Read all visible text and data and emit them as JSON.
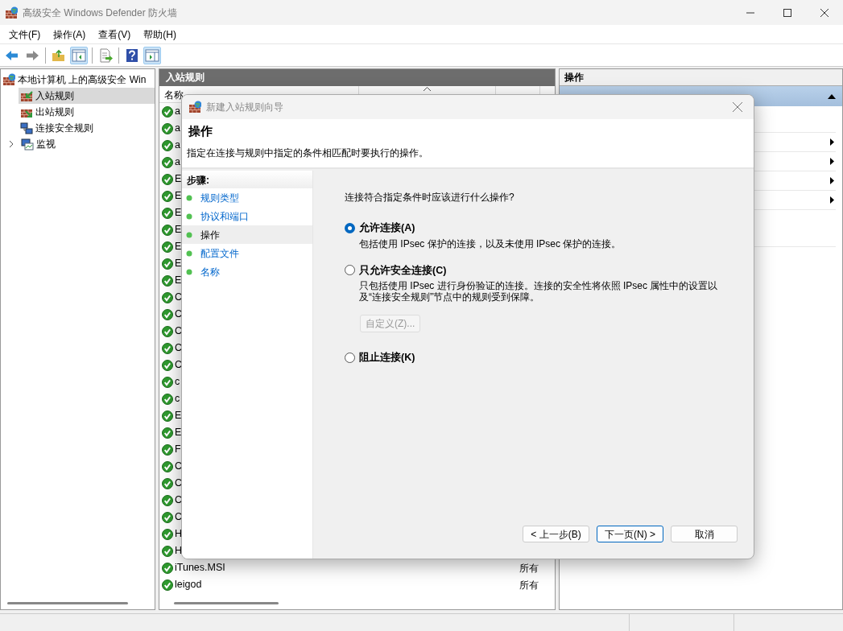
{
  "window": {
    "title": "高级安全 Windows Defender 防火墙"
  },
  "menu": [
    "文件(F)",
    "操作(A)",
    "查看(V)",
    "帮助(H)"
  ],
  "toolbar": [
    [
      {
        "kind": "back",
        "on": false
      },
      {
        "kind": "forward",
        "on": false
      }
    ],
    [
      {
        "kind": "up",
        "on": false
      },
      {
        "kind": "tree",
        "on": true
      }
    ],
    [
      {
        "kind": "export",
        "on": false
      }
    ],
    [
      {
        "kind": "help",
        "on": false
      },
      {
        "kind": "pane",
        "on": true
      }
    ]
  ],
  "tree": {
    "label": "本地计算机 上的高级安全 Win",
    "children": [
      {
        "label": "入站规则",
        "kind": "inbound",
        "selected": true
      },
      {
        "label": "出站规则",
        "kind": "outbound",
        "selected": false
      },
      {
        "label": "连接安全规则",
        "kind": "security",
        "selected": false
      },
      {
        "label": "监视",
        "kind": "monitor",
        "selected": false,
        "expanded": false
      }
    ]
  },
  "rules": {
    "title": "入站规则",
    "columns": [
      {
        "label": "名称",
        "sorted": false
      },
      {
        "sorted": true
      }
    ],
    "rows": [
      {
        "name": "a",
        "enabled": true
      },
      {
        "name": "a",
        "enabled": true
      },
      {
        "name": "a",
        "enabled": true
      },
      {
        "name": "a",
        "enabled": true
      },
      {
        "name": "E",
        "enabled": true
      },
      {
        "name": "E",
        "enabled": true
      },
      {
        "name": "E",
        "enabled": true
      },
      {
        "name": "E",
        "enabled": true
      },
      {
        "name": "E",
        "enabled": true
      },
      {
        "name": "E",
        "enabled": true
      },
      {
        "name": "E",
        "enabled": true
      },
      {
        "name": "C",
        "enabled": true
      },
      {
        "name": "C",
        "enabled": true
      },
      {
        "name": "C",
        "enabled": true
      },
      {
        "name": "C",
        "enabled": true
      },
      {
        "name": "C",
        "enabled": true
      },
      {
        "name": "c",
        "enabled": true
      },
      {
        "name": "c",
        "enabled": true
      },
      {
        "name": "E",
        "enabled": true
      },
      {
        "name": "E",
        "enabled": true
      },
      {
        "name": "F",
        "enabled": true
      },
      {
        "name": "C",
        "enabled": true
      },
      {
        "name": "C",
        "enabled": true
      },
      {
        "name": "C",
        "enabled": true
      },
      {
        "name": "C",
        "enabled": true
      },
      {
        "name": "H",
        "enabled": true
      },
      {
        "name": "H",
        "enabled": true
      },
      {
        "name": "iTunes.MSI",
        "enabled": true,
        "profile": "所有"
      },
      {
        "name": "leigod",
        "enabled": true,
        "profile": "所有"
      }
    ]
  },
  "actions": {
    "title": "操作",
    "items": [
      {
        "kind": "section",
        "expanded": true
      },
      {
        "kind": "plain"
      },
      {
        "kind": "submenu"
      },
      {
        "kind": "submenu"
      },
      {
        "kind": "submenu"
      },
      {
        "kind": "submenu"
      },
      {
        "kind": "plain"
      }
    ]
  },
  "dialog": {
    "title": "新建入站规则向导",
    "heading": "操作",
    "description": "指定在连接与规则中指定的条件相匹配时要执行的操作。",
    "steps_title": "步骤:",
    "steps": [
      {
        "label": "规则类型",
        "selected": false
      },
      {
        "label": "协议和端口",
        "selected": false
      },
      {
        "label": "操作",
        "selected": true
      },
      {
        "label": "配置文件",
        "selected": false
      },
      {
        "label": "名称",
        "selected": false
      }
    ],
    "question": "连接符合指定条件时应该进行什么操作?",
    "options": [
      {
        "label": "允许连接(A)",
        "description": "包括使用 IPsec 保护的连接，以及未使用 IPsec 保护的连接。",
        "selected": true
      },
      {
        "label": "只允许安全连接(C)",
        "description": "只包括使用 IPsec 进行身份验证的连接。连接的安全性将依照 IPsec 属性中的设置以及“连接安全规则”节点中的规则受到保障。",
        "selected": false,
        "button": {
          "label": "自定义(Z)...",
          "disabled": true
        }
      },
      {
        "label": "阻止连接(K)",
        "selected": false
      }
    ],
    "buttons": [
      {
        "label": "< 上一步(B)",
        "kind": "normal"
      },
      {
        "label": "下一页(N) >",
        "kind": "default"
      },
      {
        "label": "取消",
        "kind": "normal"
      }
    ]
  }
}
